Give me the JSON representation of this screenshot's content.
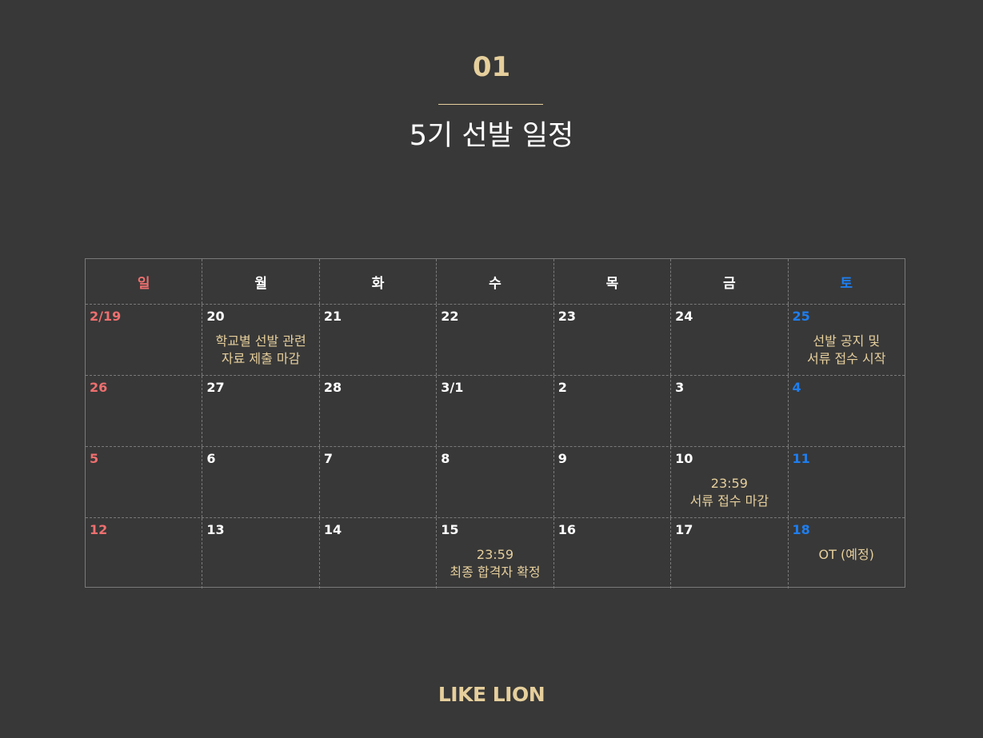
{
  "header": {
    "section_number": "01",
    "title": "5기 선발 일정"
  },
  "calendar": {
    "weekdays": [
      "일",
      "월",
      "화",
      "수",
      "목",
      "금",
      "토"
    ],
    "weeks": [
      {
        "days": [
          {
            "date": "2/19",
            "event": []
          },
          {
            "date": "20",
            "event": [
              "학교별 선발 관련",
              "자료 제출 마감"
            ]
          },
          {
            "date": "21",
            "event": []
          },
          {
            "date": "22",
            "event": []
          },
          {
            "date": "23",
            "event": []
          },
          {
            "date": "24",
            "event": []
          },
          {
            "date": "25",
            "event": [
              "선발 공지 및",
              "서류 접수 시작"
            ]
          }
        ]
      },
      {
        "days": [
          {
            "date": "26",
            "event": []
          },
          {
            "date": "27",
            "event": []
          },
          {
            "date": "28",
            "event": []
          },
          {
            "date": "3/1",
            "event": []
          },
          {
            "date": "2",
            "event": []
          },
          {
            "date": "3",
            "event": []
          },
          {
            "date": "4",
            "event": []
          }
        ]
      },
      {
        "days": [
          {
            "date": "5",
            "event": []
          },
          {
            "date": "6",
            "event": []
          },
          {
            "date": "7",
            "event": []
          },
          {
            "date": "8",
            "event": []
          },
          {
            "date": "9",
            "event": []
          },
          {
            "date": "10",
            "event": [
              "23:59",
              "서류 접수 마감"
            ]
          },
          {
            "date": "11",
            "event": []
          }
        ]
      },
      {
        "days": [
          {
            "date": "12",
            "event": []
          },
          {
            "date": "13",
            "event": []
          },
          {
            "date": "14",
            "event": []
          },
          {
            "date": "15",
            "event": [
              "23:59",
              "최종 합격자 확정"
            ]
          },
          {
            "date": "16",
            "event": []
          },
          {
            "date": "17",
            "event": []
          },
          {
            "date": "18",
            "event": [
              "OT (예정)"
            ]
          }
        ]
      }
    ]
  },
  "footer": {
    "logo_text": "LIKE LION"
  },
  "colors": {
    "background": "#383838",
    "accent_gold": "#e6cf9c",
    "sunday_red": "#ef6f6f",
    "saturday_blue": "#1e7ef0",
    "grid_line": "#7a7a7a"
  }
}
